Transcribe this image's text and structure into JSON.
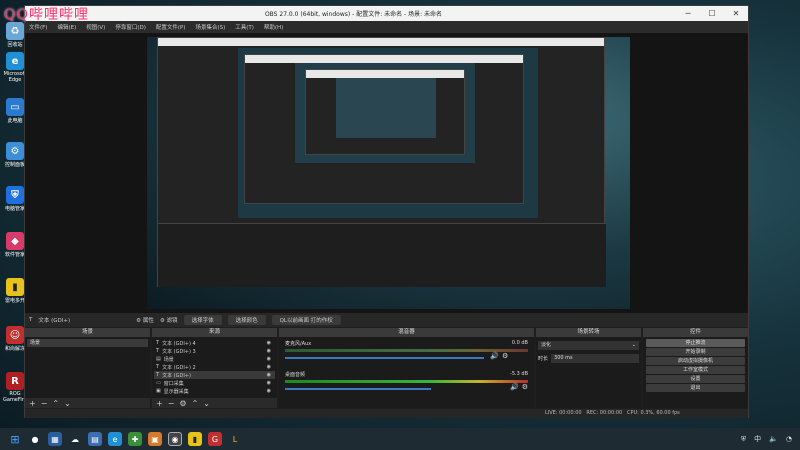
{
  "watermark": "QQ哔哩哔哩",
  "desktop_icons": [
    {
      "label": "回收站",
      "color": "#6aa7d8"
    },
    {
      "label": "Microsoft Edge",
      "color": "#1f8fd6"
    },
    {
      "label": "此电脑",
      "color": "#2a7bd0"
    },
    {
      "label": "控制面板",
      "color": "#3a8fd8"
    },
    {
      "label": "电脑管家",
      "color": "#1e6fe0"
    },
    {
      "label": "软件管家",
      "color": "#d83a6a"
    },
    {
      "label": "雷电多开",
      "color": "#e8c21a"
    },
    {
      "label": "和尚解冻",
      "color": "#c03030"
    },
    {
      "label": "ROG GameFirst",
      "color": "#b02020"
    }
  ],
  "window": {
    "title": "OBS 27.0.0 (64bit, windows) - 配置文件: 未命名 - 场景: 未命名",
    "menu": [
      "文件(F)",
      "编辑(E)",
      "视图(V)",
      "停靠窗口(D)",
      "配置文件(P)",
      "场景集合(S)",
      "工具(T)",
      "帮助(H)"
    ]
  },
  "source_toolbar": {
    "source_name": "文本 (GDI+)",
    "properties": "属性",
    "filters": "滤镜",
    "select_font": "选择字体",
    "select_color": "选择颜色",
    "text_value": "QL以前画面 打的作权"
  },
  "docks": {
    "scenes": {
      "title": "场景",
      "items": [
        "场景"
      ]
    },
    "sources": {
      "title": "来源",
      "items": [
        "文本 (GDI+) 4",
        "文本 (GDI+) 3",
        "场景",
        "文本 (GDI+) 2",
        "文本 (GDI+)",
        "窗口采集",
        "显示器采集"
      ]
    },
    "mixer": {
      "title": "混音器",
      "tracks": [
        {
          "name": "麦克风/Aux",
          "db": "0.0 dB"
        },
        {
          "name": "桌面音频",
          "db": "-5.3 dB"
        }
      ]
    },
    "transitions": {
      "title": "场景转场",
      "type": "淡化",
      "duration_label": "时长",
      "duration_value": "300 ms"
    },
    "controls": {
      "title": "控件",
      "buttons": [
        "停止推流",
        "开始录制",
        "启动虚拟摄像机",
        "工作室模式",
        "设置",
        "退出"
      ]
    }
  },
  "status": {
    "live": "LIVE: 00:00:00",
    "rec": "REC: 00:00:00",
    "cpu": "CPU: 0.3%, 60.00 fps"
  },
  "taskbar": {
    "clock": "中"
  }
}
